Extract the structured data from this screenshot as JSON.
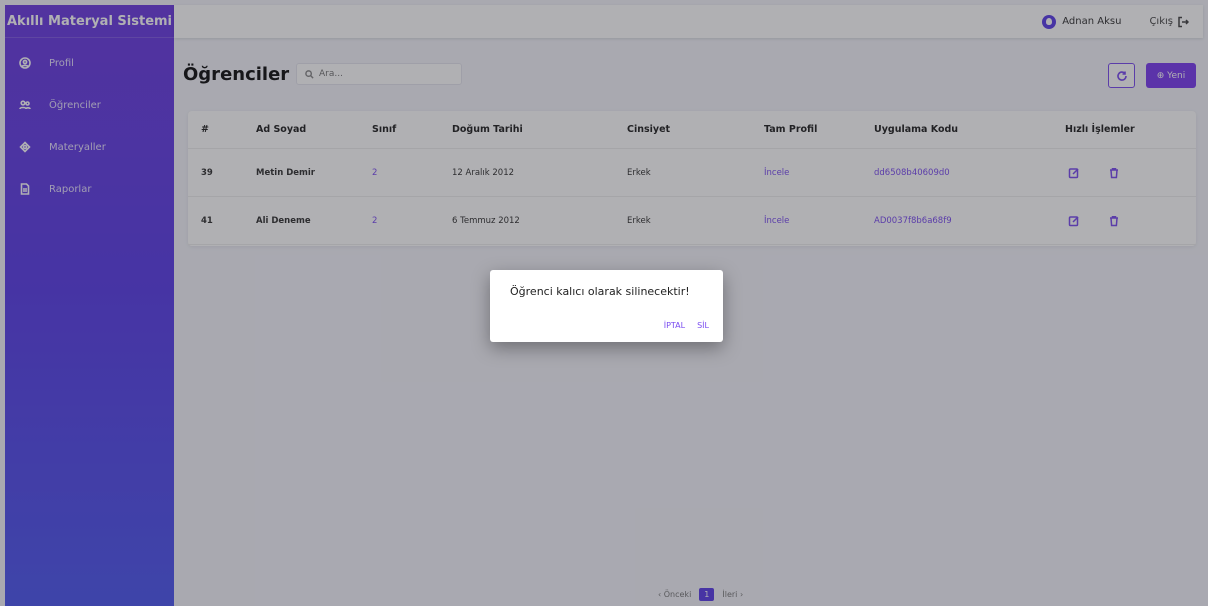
{
  "app": {
    "title": "Akıllı Materyal Sistemi"
  },
  "sidebar": {
    "items": [
      {
        "label": "Profil",
        "icon": "user-circle-icon"
      },
      {
        "label": "Öğrenciler",
        "icon": "users-icon"
      },
      {
        "label": "Materyaller",
        "icon": "layers-icon"
      },
      {
        "label": "Raporlar",
        "icon": "document-icon"
      }
    ]
  },
  "topbar": {
    "user_name": "Adnan Aksu",
    "logout_label": "Çıkış"
  },
  "page": {
    "title": "Öğrenciler",
    "search_placeholder": "Ara...",
    "new_button_label": "⊕ Yeni"
  },
  "table": {
    "headers": [
      "#",
      "Ad Soyad",
      "Sınıf",
      "Doğum Tarihi",
      "Cinsiyet",
      "Tam Profil",
      "Uygulama Kodu",
      "Hızlı İşlemler"
    ],
    "rows": [
      {
        "id": "39",
        "name": "Metin Demir",
        "class": "2",
        "birth": "12 Aralık 2012",
        "gender": "Erkek",
        "profile": "İncele",
        "code": "dd6508b40609d0"
      },
      {
        "id": "41",
        "name": "Ali Deneme",
        "class": "2",
        "birth": "6 Temmuz 2012",
        "gender": "Erkek",
        "profile": "İncele",
        "code": "AD0037f8b6a68f9"
      }
    ]
  },
  "pagination": {
    "prev": "‹ Önceki",
    "current": "1",
    "next": "İleri ›"
  },
  "dialog": {
    "message": "Öğrenci kalıcı olarak silinecektir!",
    "cancel_label": "İPTAL",
    "confirm_label": "SİL"
  },
  "colors": {
    "accent": "#7a3cf0",
    "sidebar_top": "#6c3ce0",
    "sidebar_bottom": "#4e58f0"
  }
}
